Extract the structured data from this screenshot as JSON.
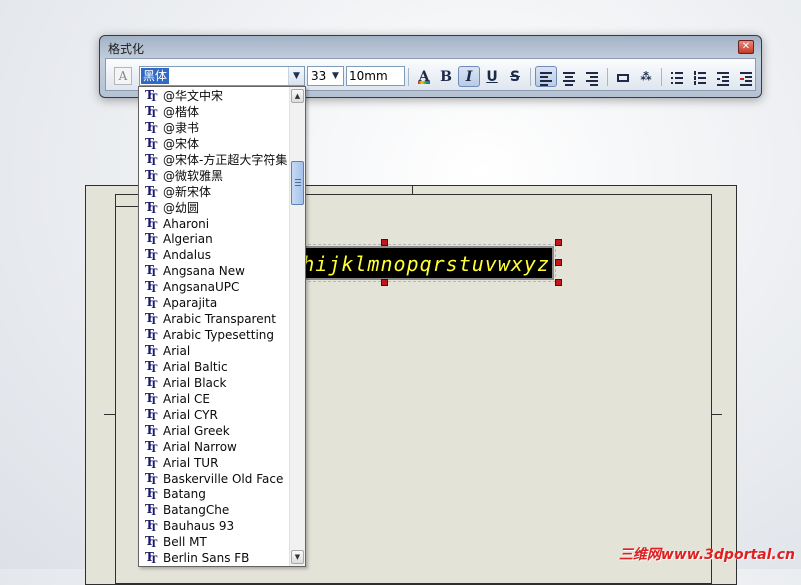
{
  "window": {
    "title": "格式化"
  },
  "toolbar": {
    "font_value": "黑体",
    "size_value": "33",
    "height_value": "10mm",
    "buttons": {
      "color_label": "A",
      "bold_label": "B",
      "italic_label": "I",
      "underline_label": "U",
      "strike_label": "S"
    }
  },
  "font_list": [
    "@华文中宋",
    "@楷体",
    "@隶书",
    "@宋体",
    "@宋体-方正超大字符集",
    "@微软雅黑",
    "@新宋体",
    "@幼圆",
    "Aharoni",
    "Algerian",
    "Andalus",
    "Angsana New",
    "AngsanaUPC",
    "Aparajita",
    "Arabic Transparent",
    "Arabic Typesetting",
    "Arial",
    "Arial Baltic",
    "Arial Black",
    "Arial CE",
    "Arial CYR",
    "Arial Greek",
    "Arial Narrow",
    "Arial TUR",
    "Baskerville Old Face",
    "Batang",
    "BatangChe",
    "Bauhaus 93",
    "Bell MT",
    "Berlin Sans FB"
  ],
  "drawing": {
    "note_text": "hijklmnopqrstuvwxyz"
  },
  "watermark": "三维网www.3dportal.cn",
  "colors": {
    "selection": "#316ac5",
    "note_text": "#ffff33",
    "handle": "#c0161c",
    "watermark": "#e02020"
  },
  "icons": {
    "font_item": "truetype-icon",
    "style": "text-style-icon"
  }
}
